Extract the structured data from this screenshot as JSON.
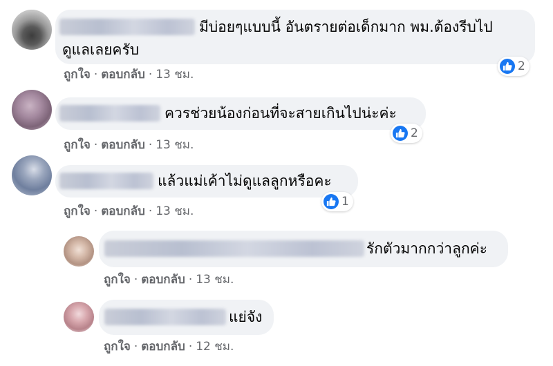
{
  "colors": {
    "bubble": "#f0f2f5",
    "like_blue": "#1877f2",
    "meta_text": "#65676b"
  },
  "comments": [
    {
      "text_line1": "มีบ่อยๆแบบนี้ อันตรายต่อเด็กมาก พม.ต้องรีบไป",
      "text_line2": "ดูแลเลยครับ",
      "like": "ถูกใจ",
      "reply": "ตอบกลับ",
      "dot": "·",
      "time": "13 ชม.",
      "reaction_icon": "like-thumb-icon",
      "reaction_count": "2"
    },
    {
      "text": "ควรช่วยน้องก่อนที่จะสายเกินไปน่ะค่ะ",
      "like": "ถูกใจ",
      "reply": "ตอบกลับ",
      "dot": "·",
      "time": "13 ชม.",
      "reaction_icon": "like-thumb-icon",
      "reaction_count": "2"
    },
    {
      "text": "แล้วแม่เค้าไม่ดูแลลูกหรือคะ",
      "like": "ถูกใจ",
      "reply": "ตอบกลับ",
      "dot": "·",
      "time": "13 ชม.",
      "reaction_icon": "like-thumb-icon",
      "reaction_count": "1"
    },
    {
      "text": "รักตัวมากกว่าลูกค่ะ",
      "like": "ถูกใจ",
      "reply": "ตอบกลับ",
      "dot": "·",
      "time": "13 ชม."
    },
    {
      "text": "แย่จัง",
      "like": "ถูกใจ",
      "reply": "ตอบกลับ",
      "dot": "·",
      "time": "12 ชม."
    }
  ]
}
